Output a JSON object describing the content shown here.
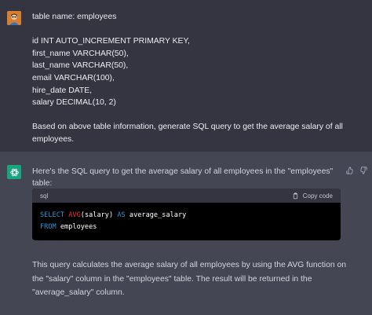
{
  "user_message": {
    "line1": "table name: employees",
    "columns": [
      "id INT AUTO_INCREMENT PRIMARY KEY,",
      "first_name VARCHAR(50),",
      "last_name VARCHAR(50),",
      "email VARCHAR(100),",
      "hire_date DATE,",
      "salary DECIMAL(10, 2)"
    ],
    "request_line1": "Based on above table information, generate SQL query to get the average salary of all",
    "request_line2": "employees."
  },
  "assistant_message": {
    "intro": "Here's the SQL query to get the average salary of all employees in the \"employees\" table:",
    "code": {
      "language": "sql",
      "copy_label": "Copy code",
      "line1": {
        "select": "SELECT",
        "func": "AVG",
        "args": "(salary)",
        "as": "AS",
        "alias": " average_salary"
      },
      "line2": {
        "from": "FROM",
        "table": " employees"
      }
    },
    "explanation_line1": "This query calculates the average salary of all employees by using the AVG function on",
    "explanation_line2": "the \"salary\" column in the \"employees\" table. The result will be returned in the",
    "explanation_line3": "\"average_salary\" column."
  },
  "icons": {
    "user_avatar": "user-avatar-icon",
    "bot_avatar": "chatgpt-logo-icon",
    "thumbs_up": "thumbs-up-icon",
    "thumbs_down": "thumbs-down-icon",
    "copy": "clipboard-icon"
  },
  "colors": {
    "user_bg": "#343541",
    "assistant_bg": "#444654",
    "bot_avatar": "#19a37f",
    "keyword": "#2e95d3",
    "function": "#f22c3d"
  }
}
